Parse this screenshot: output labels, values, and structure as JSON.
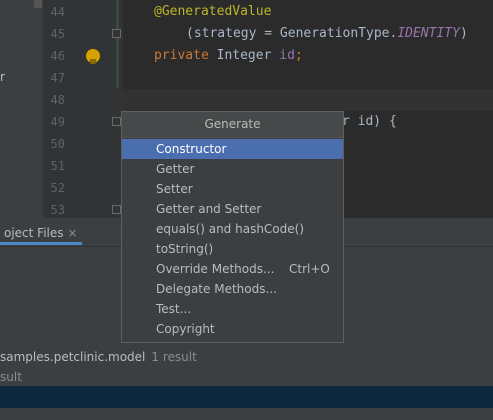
{
  "editor": {
    "line_numbers": [
      "44",
      "45",
      "46",
      "47",
      "48",
      "49",
      "50",
      "51",
      "52",
      "53"
    ],
    "line44": {
      "annotation": "@GeneratedValue"
    },
    "line45": {
      "text_before": "(strategy = GenerationType.",
      "constant": "IDENTITY",
      "text_after": ")"
    },
    "line46": {
      "keyword": "private",
      "type": "Integer",
      "field": "id",
      "semicolon": ";"
    },
    "line49_fragment": "r id) {"
  },
  "left_strip": {
    "letter": "r"
  },
  "bottom_panel": {
    "tab_label": "oject Files",
    "tab_close": "×",
    "result_text": "samples.petclinic.model",
    "result_count": "1 result",
    "result_text2": "sult"
  },
  "popup": {
    "title": "Generate",
    "items": [
      {
        "label": "Constructor",
        "selected": true
      },
      {
        "label": "Getter"
      },
      {
        "label": "Setter"
      },
      {
        "label": "Getter and Setter"
      },
      {
        "label": "equals() and hashCode()"
      },
      {
        "label": "toString()"
      },
      {
        "label": "Override Methods...",
        "shortcut": "Ctrl+O"
      },
      {
        "label": "Delegate Methods..."
      },
      {
        "label": "Test..."
      },
      {
        "label": "Copyright"
      }
    ]
  },
  "icons": {
    "intention_bulb": "lightbulb-icon"
  },
  "colors": {
    "selection": "#4b6eaf",
    "annotation": "#bbb529",
    "keyword": "#cc7832"
  }
}
